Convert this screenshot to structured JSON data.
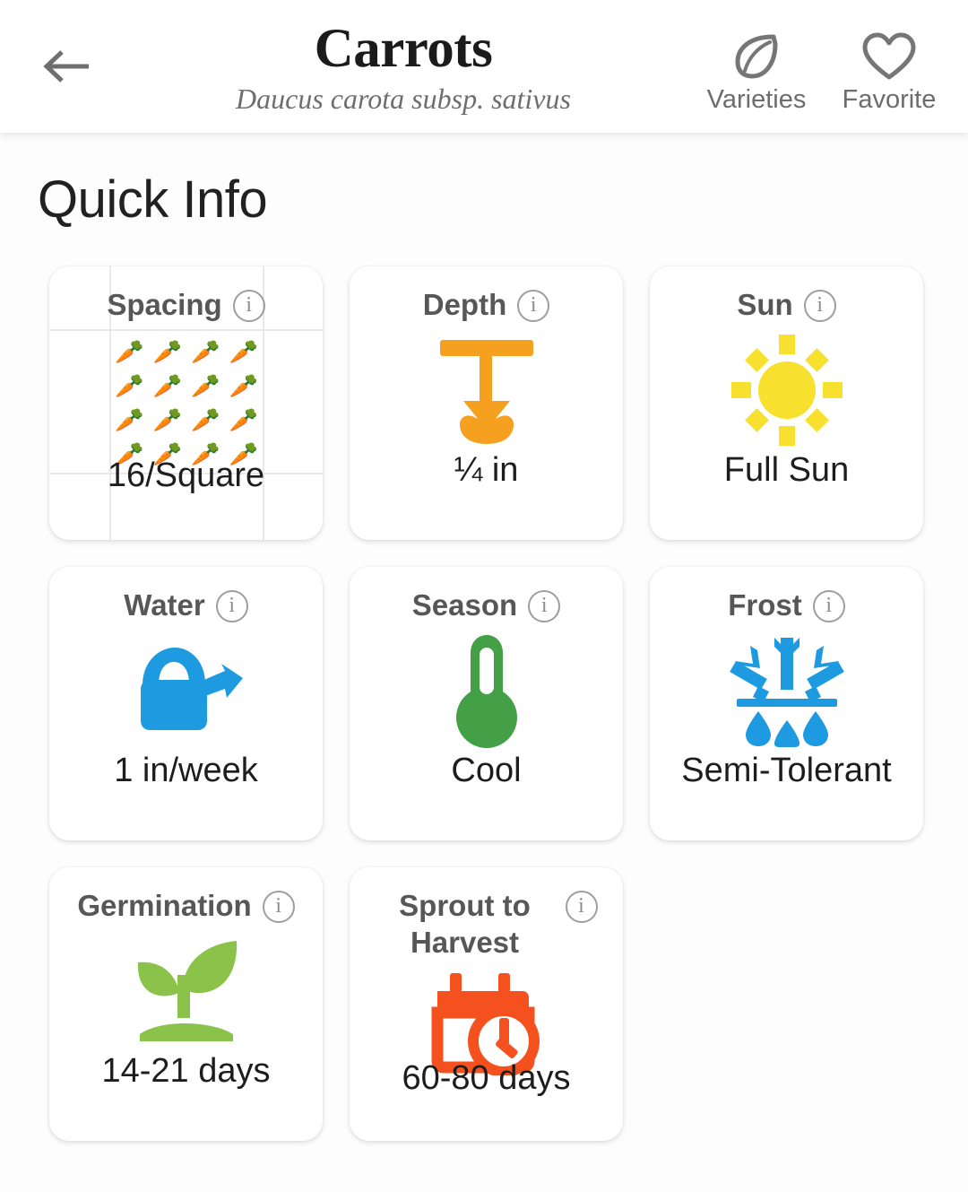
{
  "header": {
    "back_icon": "arrow-left-icon",
    "title": "Carrots",
    "subtitle": "Daucus carota subsp. sativus",
    "actions": [
      {
        "icon": "leaf-icon",
        "label": "Varieties"
      },
      {
        "icon": "heart-icon",
        "label": "Favorite"
      }
    ]
  },
  "section": {
    "title": "Quick Info"
  },
  "info_icon_glyph": "i",
  "colors": {
    "depth": "#F5A01E",
    "sun": "#F7E12E",
    "water": "#1E9BE0",
    "season": "#43A047",
    "frost": "#1E9BE0",
    "germination": "#8BC34A",
    "harvest": "#F4511E",
    "card_title": "#575757",
    "card_value": "#1d1d1d",
    "grid_line": "#e9e9e9"
  },
  "cards": [
    {
      "key": "spacing",
      "title": "Spacing",
      "value": "16/Square",
      "icon": "carrot-spacing-grid-icon",
      "carrot_glyph": "🥕",
      "carrot_rows": 4,
      "carrot_cols": 4,
      "info_label": "Spacing info"
    },
    {
      "key": "depth",
      "title": "Depth",
      "value": "¼ in",
      "icon": "planting-depth-icon",
      "info_label": "Depth info"
    },
    {
      "key": "sun",
      "title": "Sun",
      "value": "Full Sun",
      "icon": "sun-icon",
      "info_label": "Sun info"
    },
    {
      "key": "water",
      "title": "Water",
      "value": "1 in/week",
      "icon": "watering-can-icon",
      "info_label": "Water info"
    },
    {
      "key": "season",
      "title": "Season",
      "value": "Cool",
      "icon": "thermometer-icon",
      "info_label": "Season info"
    },
    {
      "key": "frost",
      "title": "Frost",
      "value": "Semi-Tolerant",
      "icon": "melting-snowflake-icon",
      "info_label": "Frost info"
    },
    {
      "key": "germination",
      "title": "Germination",
      "value": "14-21 days",
      "icon": "seedling-icon",
      "info_label": "Germination info"
    },
    {
      "key": "harvest",
      "title": "Sprout to Harvest",
      "value": "60-80 days",
      "icon": "calendar-clock-icon",
      "info_label": "Sprout to Harvest info"
    }
  ]
}
